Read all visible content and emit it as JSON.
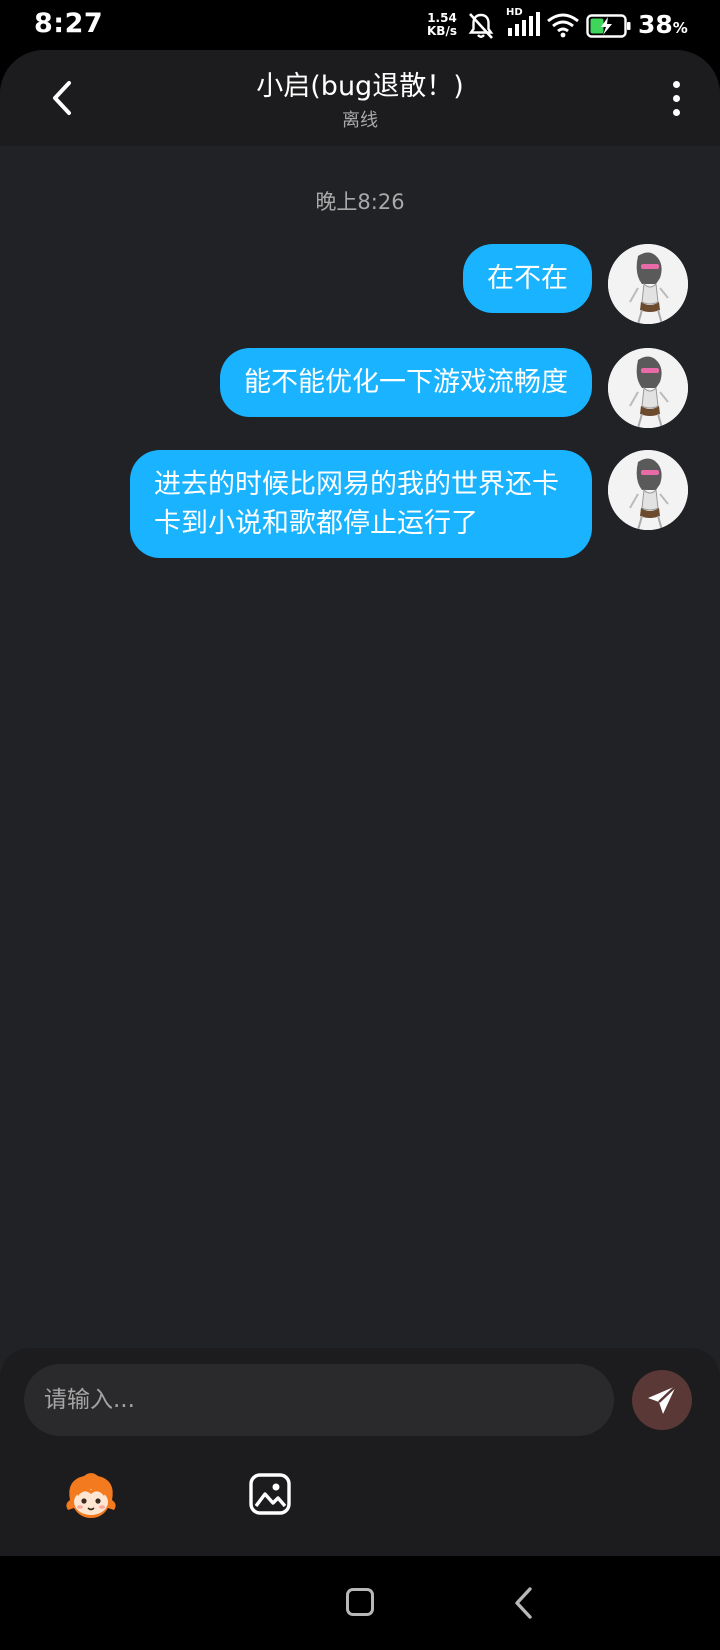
{
  "status_bar": {
    "time": "8:27",
    "net_speed_value": "1.54",
    "net_speed_unit": "KB/s",
    "signal_label": "HD",
    "battery_percent": "38",
    "battery_percent_sign": "%",
    "icons": [
      "mute-bell-icon",
      "signal-icon",
      "wifi-icon",
      "battery-charging-icon"
    ]
  },
  "header": {
    "title": "小启(bug退散！)",
    "status": "离线"
  },
  "conversation": {
    "timestamp": "晚上8:26",
    "messages": [
      {
        "text": "在不在"
      },
      {
        "text": "能不能优化一下游戏流畅度"
      },
      {
        "text": "进去的时候比网易的我的世界还卡卡到小说和歌都停止运行了"
      }
    ]
  },
  "composer": {
    "placeholder": "请输入..."
  },
  "colors": {
    "bubble": "#19b3ff",
    "background": "#202225",
    "send_button": "#5a3836"
  }
}
